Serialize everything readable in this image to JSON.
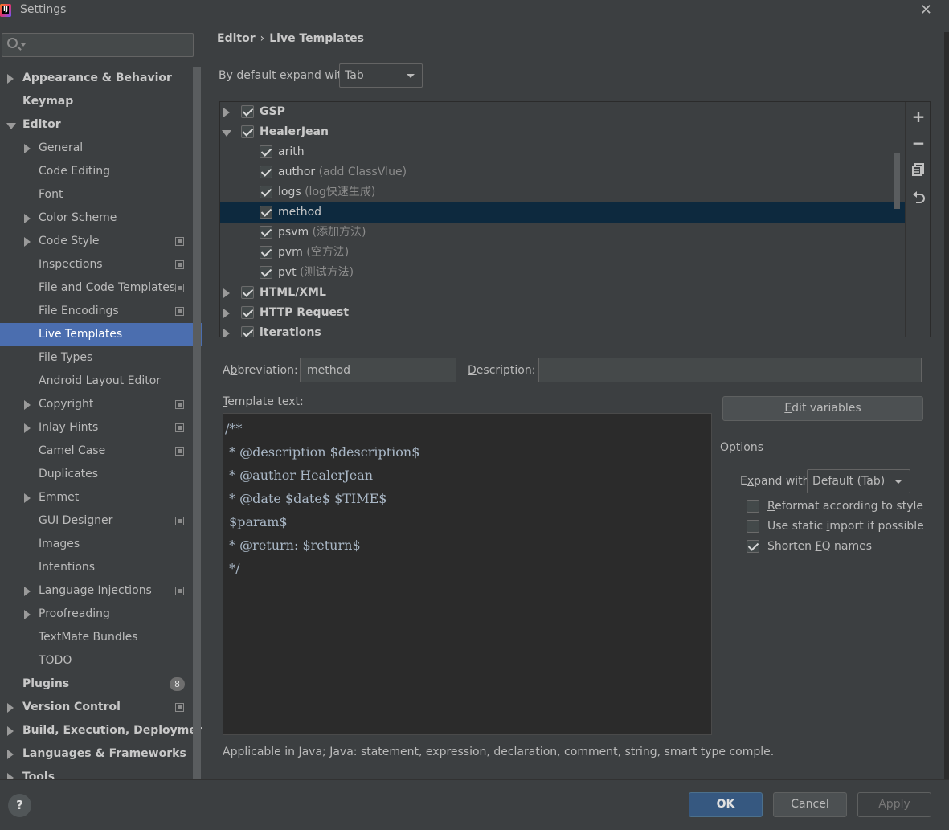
{
  "window": {
    "title": "Settings"
  },
  "search": {
    "value": "",
    "placeholder": ""
  },
  "sidebar": {
    "items": [
      {
        "label": "Appearance & Behavior",
        "level": 0,
        "arrow": "right"
      },
      {
        "label": "Keymap",
        "level": 0,
        "arrow": "none"
      },
      {
        "label": "Editor",
        "level": 0,
        "arrow": "down"
      },
      {
        "label": "General",
        "level": 1,
        "arrow": "right"
      },
      {
        "label": "Code Editing",
        "level": 1,
        "arrow": "none"
      },
      {
        "label": "Font",
        "level": 1,
        "arrow": "none"
      },
      {
        "label": "Color Scheme",
        "level": 1,
        "arrow": "right"
      },
      {
        "label": "Code Style",
        "level": 1,
        "arrow": "right",
        "project_icon": true
      },
      {
        "label": "Inspections",
        "level": 1,
        "arrow": "none",
        "project_icon": true
      },
      {
        "label": "File and Code Templates",
        "level": 1,
        "arrow": "none",
        "project_icon": true
      },
      {
        "label": "File Encodings",
        "level": 1,
        "arrow": "none",
        "project_icon": true
      },
      {
        "label": "Live Templates",
        "level": 1,
        "arrow": "none",
        "selected": true
      },
      {
        "label": "File Types",
        "level": 1,
        "arrow": "none"
      },
      {
        "label": "Android Layout Editor",
        "level": 1,
        "arrow": "none"
      },
      {
        "label": "Copyright",
        "level": 1,
        "arrow": "right",
        "project_icon": true
      },
      {
        "label": "Inlay Hints",
        "level": 1,
        "arrow": "right",
        "project_icon": true
      },
      {
        "label": "Camel Case",
        "level": 1,
        "arrow": "none",
        "project_icon": true
      },
      {
        "label": "Duplicates",
        "level": 1,
        "arrow": "none"
      },
      {
        "label": "Emmet",
        "level": 1,
        "arrow": "right"
      },
      {
        "label": "GUI Designer",
        "level": 1,
        "arrow": "none",
        "project_icon": true
      },
      {
        "label": "Images",
        "level": 1,
        "arrow": "none"
      },
      {
        "label": "Intentions",
        "level": 1,
        "arrow": "none"
      },
      {
        "label": "Language Injections",
        "level": 1,
        "arrow": "right",
        "project_icon": true
      },
      {
        "label": "Proofreading",
        "level": 1,
        "arrow": "right"
      },
      {
        "label": "TextMate Bundles",
        "level": 1,
        "arrow": "none"
      },
      {
        "label": "TODO",
        "level": 1,
        "arrow": "none"
      },
      {
        "label": "Plugins",
        "level": 0,
        "arrow": "none",
        "badge": "8"
      },
      {
        "label": "Version Control",
        "level": 0,
        "arrow": "right",
        "project_icon": true
      },
      {
        "label": "Build, Execution, Deploymen",
        "level": 0,
        "arrow": "right"
      },
      {
        "label": "Languages & Frameworks",
        "level": 0,
        "arrow": "right"
      },
      {
        "label": "Tools",
        "level": 0,
        "arrow": "right"
      }
    ]
  },
  "breadcrumb": {
    "parent": "Editor",
    "separator": "›",
    "current": "Live Templates"
  },
  "expand": {
    "label": "By default expand with",
    "value": "Tab"
  },
  "templates": [
    {
      "name": "GSP",
      "type": "group",
      "expanded": false,
      "checked": true
    },
    {
      "name": "HealerJean",
      "type": "group",
      "expanded": true,
      "checked": true
    },
    {
      "name": "arith",
      "desc": "",
      "type": "child",
      "checked": true
    },
    {
      "name": "author",
      "desc": "(add ClassVlue)",
      "type": "child",
      "checked": true
    },
    {
      "name": "logs",
      "desc": "(log快速生成)",
      "type": "child",
      "checked": true
    },
    {
      "name": "method",
      "desc": "",
      "type": "child",
      "checked": true,
      "selected": true
    },
    {
      "name": "psvm",
      "desc": "(添加方法)",
      "type": "child",
      "checked": true
    },
    {
      "name": "pvm",
      "desc": "(空方法)",
      "type": "child",
      "checked": true
    },
    {
      "name": "pvt",
      "desc": "(测试方法)",
      "type": "child",
      "checked": true
    },
    {
      "name": "HTML/XML",
      "type": "group",
      "expanded": false,
      "checked": true
    },
    {
      "name": "HTTP Request",
      "type": "group",
      "expanded": false,
      "checked": true
    },
    {
      "name": "iterations",
      "type": "group",
      "expanded": false,
      "checked": true
    }
  ],
  "toolbar": {
    "add": "+",
    "remove": "−",
    "copy_icon": "copy-icon",
    "revert_icon": "revert-icon"
  },
  "abbreviation": {
    "label_pre": "A",
    "label_u": "b",
    "label_post": "breviation:",
    "value": "method"
  },
  "description": {
    "label_u": "D",
    "label_post": "escription:",
    "value": ""
  },
  "template_text": {
    "label_u": "T",
    "label_post": "emplate text:",
    "lines": [
      "/**",
      " * @description $description$",
      " * @author HealerJean",
      " * @date $date$ $TIME$",
      " $param$",
      " * @return: $return$",
      " */"
    ]
  },
  "edit_variables": {
    "label_u": "E",
    "label_post": "dit variables"
  },
  "options": {
    "title": "Options",
    "expand_label_pre": "E",
    "expand_label_u": "x",
    "expand_label_post": "pand with",
    "expand_value": "Default (Tab)",
    "reformat": {
      "pre": "",
      "u": "R",
      "post": "eformat according to style",
      "checked": false
    },
    "static_import": {
      "pre": "Use static ",
      "u": "i",
      "post": "mport if possible",
      "checked": false
    },
    "shorten": {
      "pre": "Shorten ",
      "u": "F",
      "post": "Q names",
      "checked": true
    }
  },
  "applicable": "Applicable in Java; Java: statement, expression, declaration, comment, string, smart type comple.",
  "buttons": {
    "ok": "OK",
    "cancel": "Cancel",
    "apply": "Apply",
    "help": "?"
  },
  "colors": {
    "selection": "#4b6eaf",
    "tree_selection": "#0d293e",
    "ok_button": "#365880",
    "editor_bg": "#2b2b2b"
  }
}
